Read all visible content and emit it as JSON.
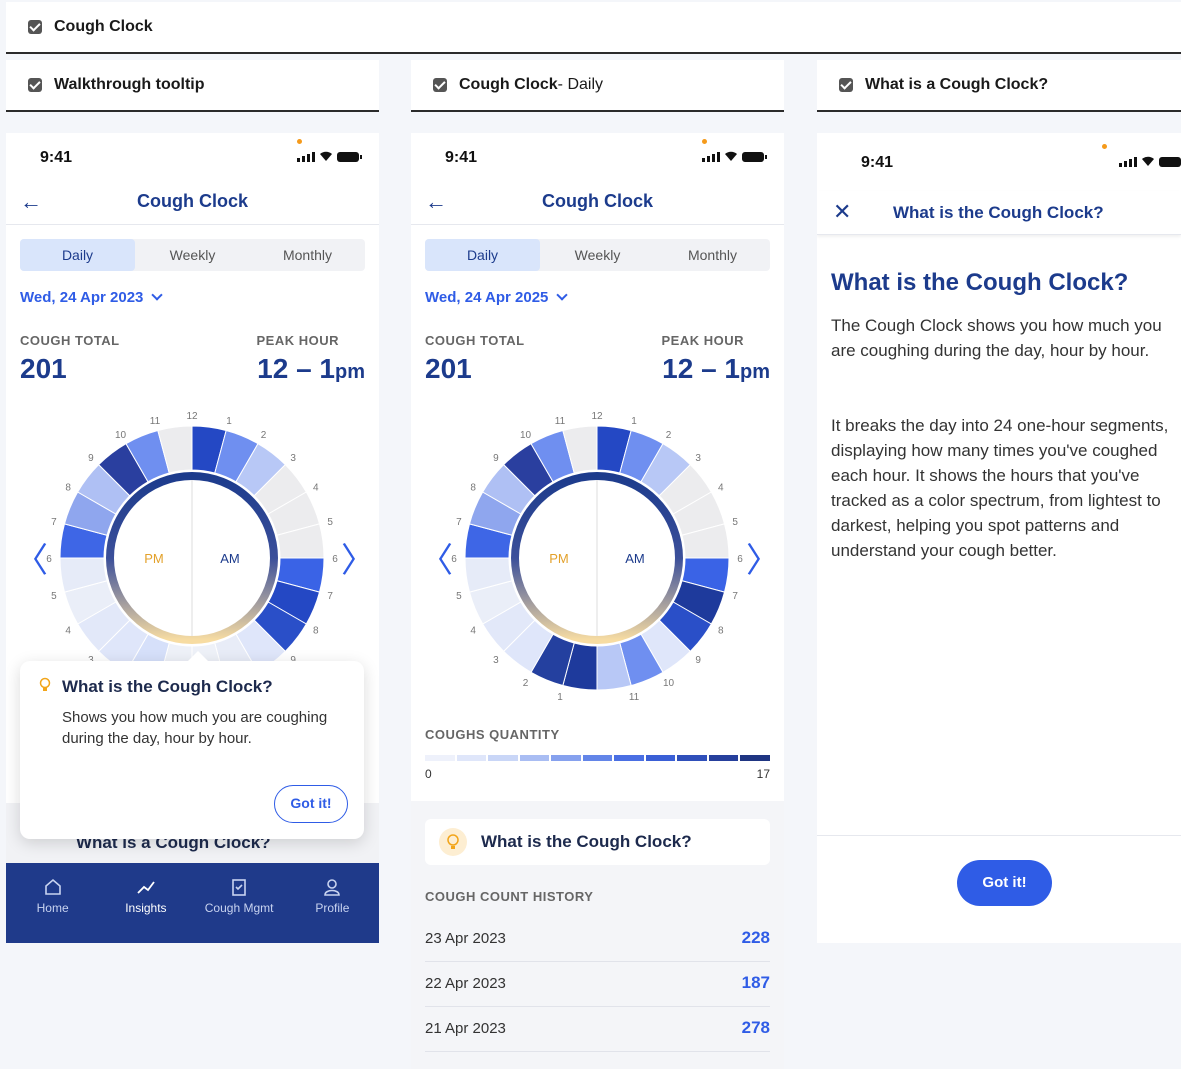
{
  "labels": {
    "top": "Cough Clock",
    "walkthrough": "Walkthrough tooltip",
    "daily_bold": "Cough Clock",
    "daily_rest": " - Daily",
    "what": "What is a Cough Clock?"
  },
  "status": {
    "time": "9:41"
  },
  "screen1": {
    "title": "Cough Clock",
    "tabs": [
      "Daily",
      "Weekly",
      "Monthly"
    ],
    "date": "Wed, 24 Apr 2023",
    "cough_total_label": "COUGH TOTAL",
    "cough_total": "201",
    "peak_hour_label": "PEAK HOUR",
    "peak_hour": "12 – 1",
    "peak_suffix": "pm",
    "pm": "PM",
    "am": "AM",
    "tooltip": {
      "title": "What is the Cough Clock?",
      "body": "Shows you how much you are coughing during the day, hour by hour.",
      "button": "Got it!"
    },
    "under_card": "What is a Cough Clock?",
    "tabbar": [
      "Home",
      "Insights",
      "Cough Mgmt",
      "Profile"
    ]
  },
  "screen2": {
    "title": "Cough Clock",
    "tabs": [
      "Daily",
      "Weekly",
      "Monthly"
    ],
    "date": "Wed, 24 Apr 2025",
    "cough_total_label": "COUGH TOTAL",
    "cough_total": "201",
    "peak_hour_label": "PEAK HOUR",
    "peak_hour": "12 – 1",
    "peak_suffix": "pm",
    "pm": "PM",
    "am": "AM",
    "qty_label": "COUGHS QUANTITY",
    "qty_min": "0",
    "qty_max": "17",
    "what_card": "What is the Cough Clock?",
    "history_label": "COUGH COUNT HISTORY",
    "history": [
      {
        "date": "23 Apr 2023",
        "value": "228"
      },
      {
        "date": "22 Apr 2023",
        "value": "187"
      },
      {
        "date": "21 Apr 2023",
        "value": "278"
      }
    ]
  },
  "screen3": {
    "nav_title": "What is the Cough Clock?",
    "heading": "What is the Cough Clock?",
    "p1": "The Cough Clock shows you how much you are coughing during the day, hour by hour.",
    "p2": "It breaks the day into 24 one-hour segments, displaying how many times you've coughed each hour. It shows the hours that you've tracked as a color spectrum, from lightest to darkest, helping you spot patterns and understand your cough better.",
    "button": "Got it!"
  },
  "clock_hours_am": [
    "12",
    "1",
    "2",
    "3",
    "4",
    "5",
    "6",
    "7",
    "8",
    "9",
    "10",
    "11"
  ],
  "clock_hours_pm": [
    "12",
    "11",
    "10",
    "9",
    "8",
    "7",
    "6",
    "5",
    "4",
    "3",
    "2",
    "1"
  ],
  "colors": {
    "accent": "#2f5ce6",
    "navy": "#1c3b8c",
    "tabbar": "#1f3a8a"
  }
}
